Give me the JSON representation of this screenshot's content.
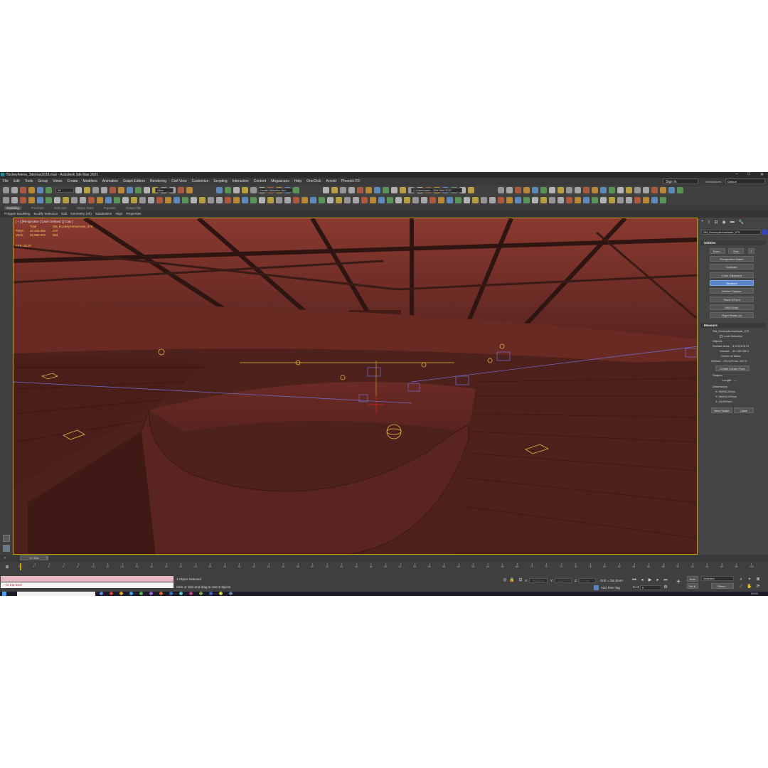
{
  "window": {
    "title": "HockeyArena_3dsmax2018.max - Autodesk 3ds Max 2021",
    "controls": [
      "–",
      "□",
      "✕"
    ]
  },
  "menubar": {
    "items": [
      "File",
      "Edit",
      "Tools",
      "Group",
      "Views",
      "Create",
      "Modifiers",
      "Animation",
      "Graph Editors",
      "Rendering",
      "Civil View",
      "Customize",
      "Scripting",
      "Interactive",
      "Content",
      "Megascans",
      "Help",
      "OneClick",
      "Arnold",
      "Phoenix FD"
    ],
    "sign_in": "Sign In",
    "workspaces_label": "Workspaces:",
    "workspaces_value": "Default"
  },
  "toolbar": {
    "filter_value": "All",
    "view_value": "View",
    "selection_set_placeholder": "Create Selection Set",
    "project_path": "C:\\Users\\adm...\\3ds Max 2021"
  },
  "ribbon": {
    "tabs": [
      "Modeling",
      "Freeform",
      "Selection",
      "Object Paint",
      "Populate",
      "Dataprofile"
    ],
    "active_tab": "Modeling",
    "items": [
      "Polygon Modeling",
      "Modify Selection",
      "Edit",
      "Geometry (All)",
      "Subdivision",
      "Align",
      "Properties"
    ]
  },
  "viewport": {
    "label": "[ + ] [Perspective ] [User Defined ] [ Clay ]",
    "stats_headers": [
      "Total",
      "SM_HockeyArenaAsset_473"
    ],
    "stats": [
      {
        "label": "Polys:",
        "total": "20 342 065",
        "selected": "270"
      },
      {
        "label": "Verts:",
        "total": "26 082 372",
        "selected": "554"
      }
    ],
    "fps_label": "FPS:",
    "fps_value": "36,27"
  },
  "command_panel": {
    "tab_icons": [
      "create-icon",
      "modify-icon",
      "hierarchy-icon",
      "motion-icon",
      "display-icon",
      "utilities-icon"
    ],
    "object_name": "SM_HockeyArenaAsset_473",
    "object_color": "#3444c8",
    "utilities": {
      "title": "Utilities",
      "more_label": "More...",
      "sets_label": "Sets",
      "buttons": [
        "Perspective Match",
        "Collapse",
        "Color Clipboard",
        "Measure",
        "Motion Capture",
        "Reset XForm",
        "MAXScript",
        "Flight Studio (c)"
      ],
      "active": "Measure"
    },
    "measure": {
      "title": "Measure",
      "object_name": "SM_HockeyArenaAsset_473",
      "lock_selection": "Lock Selection",
      "objects_label": "Objects",
      "surface_area_label": "Surface Area:",
      "surface_area": "3 578 676 37",
      "volume_label": "Volume:",
      "volume": "44 139 080 4",
      "center_of_mass_label": "Center of Mass:",
      "center_of_mass": "945mm, -1914,47mm, 667,3",
      "create_center_point": "Create Center Point",
      "shapes_label": "Shapes",
      "length_label": "Length:",
      "length_value": "---",
      "dimensions_label": "Dimensions",
      "dim_x": "X:  90893,25mm",
      "dim_y": "Y:  36404,129mm",
      "dim_z": "Z:  24,697mm",
      "new_floater": "New Floater",
      "close": "Close"
    }
  },
  "timeline": {
    "frame": "0 / 100",
    "ticks": [
      "0",
      "2",
      "4",
      "6",
      "8",
      "10",
      "12",
      "14",
      "16",
      "18",
      "20",
      "22",
      "24",
      "26",
      "28",
      "30",
      "32",
      "34",
      "36",
      "38",
      "40",
      "42",
      "44",
      "46",
      "48",
      "50",
      "52",
      "54",
      "56",
      "58",
      "60",
      "62",
      "64",
      "66",
      "68",
      "70",
      "72",
      "74",
      "76",
      "78",
      "80",
      "82",
      "84",
      "86",
      "88",
      "90",
      "92",
      "94",
      "96",
      "98",
      "100"
    ]
  },
  "status": {
    "maxscript_output": "-- In top-level",
    "selected": "1 Object Selected",
    "prompt": "Click or click-and-drag to select objects",
    "x_label": "X:",
    "x_value": "-9895,844",
    "y_label": "Y:",
    "y_value": "-1637,703",
    "z_label": "Z:",
    "z_value": "0,0mm",
    "grid": "Grid = 254,0mm",
    "add_time_tag": "Add Time Tag",
    "auto": "Auto",
    "set_k": "Set K.",
    "selected_dropdown": "Selected",
    "filters": "Filters...",
    "current_frame": "0",
    "clock": "09:50"
  },
  "colors": {
    "viewport_bg": "#5a2620",
    "accent": "#c9a300",
    "selection_blue": "#5a86c8"
  }
}
